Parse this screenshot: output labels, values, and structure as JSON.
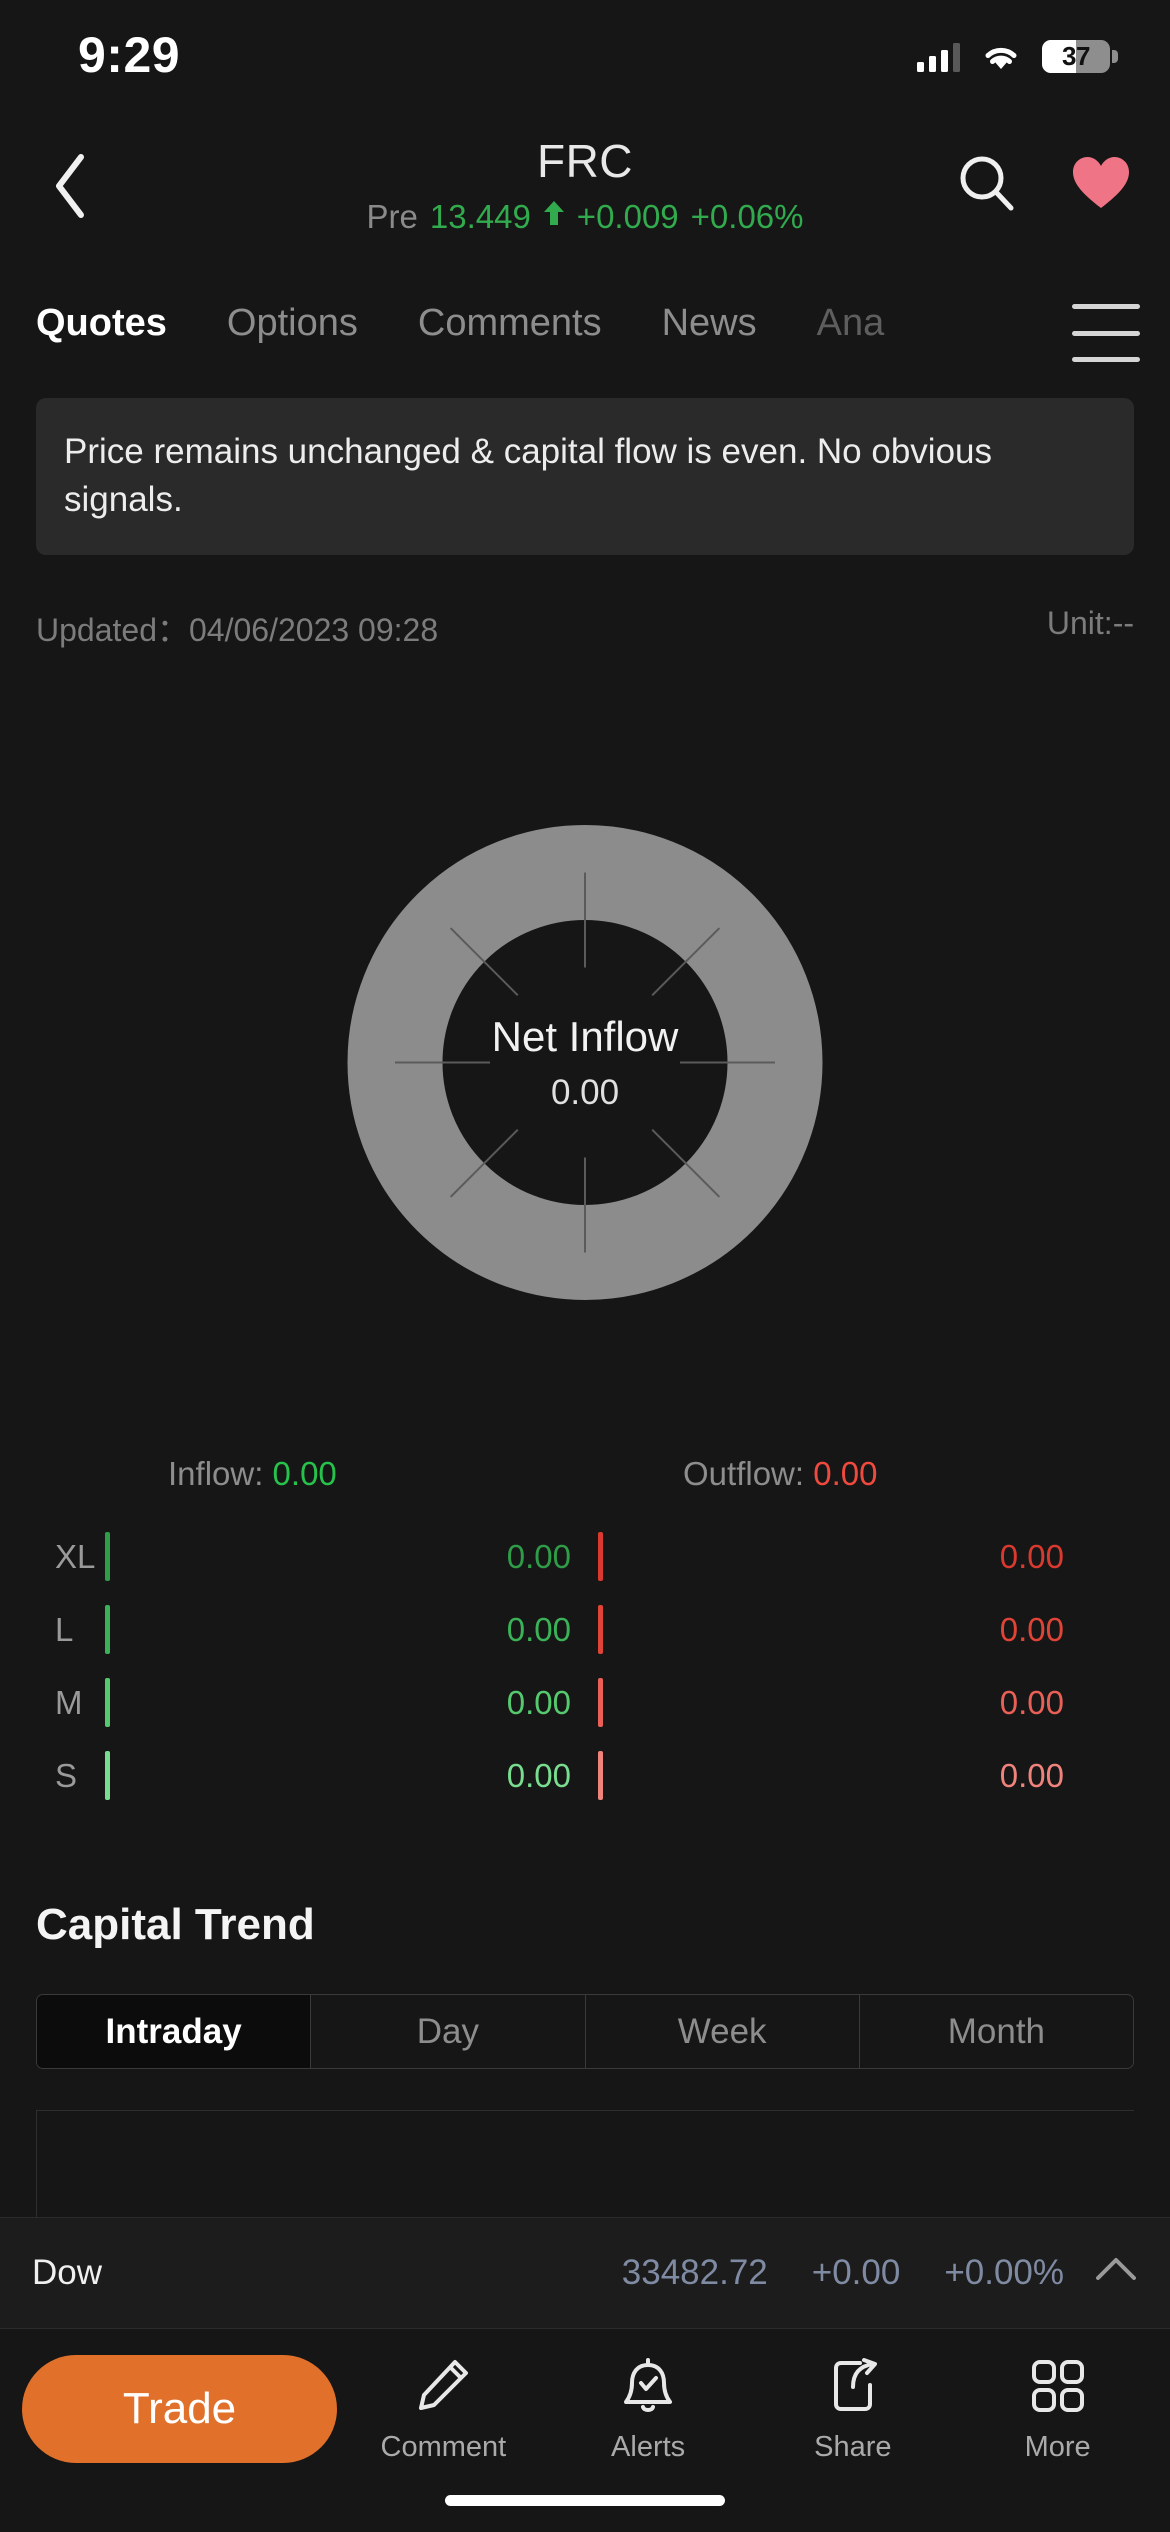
{
  "status_bar": {
    "time": "9:29",
    "battery_percent": "37",
    "icons": [
      "cellular-signal-icon",
      "wifi-icon",
      "battery-icon"
    ]
  },
  "header": {
    "back_icon": "chevron-left-icon",
    "symbol": "FRC",
    "session_label": "Pre",
    "last_price": "13.449",
    "direction_arrow": "⬆",
    "change": "+0.009",
    "change_percent": "+0.06%",
    "up_color": "#31ab4d",
    "search_icon": "search-icon",
    "favorite_icon": "heart-icon",
    "favorite_color": "#ef7486",
    "menu_icon": "hamburger-menu-icon"
  },
  "tabs": {
    "items": [
      {
        "label": "Quotes",
        "active": true
      },
      {
        "label": "Options",
        "active": false
      },
      {
        "label": "Comments",
        "active": false
      },
      {
        "label": "News",
        "active": false
      },
      {
        "label": "Ana",
        "active": false
      }
    ],
    "accent": "#e0702a"
  },
  "notice": {
    "text": "Price remains unchanged & capital flow is even. No obvious signals."
  },
  "meta": {
    "updated_label": "Updated：",
    "updated_value": "04/06/2023 09:28",
    "unit": "Unit:--"
  },
  "donut": {
    "center_label": "Net Inflow",
    "center_value": "0.00",
    "ring_color": "#8c8c8c",
    "segments": 8
  },
  "flow_summary": {
    "inflow_label": "Inflow:",
    "inflow_value": "0.00",
    "inflow_color": "#27c24c",
    "outflow_label": "Outflow:",
    "outflow_value": "0.00",
    "outflow_color": "#f04a3f"
  },
  "flow_rows": [
    {
      "label": "XL",
      "inflow": "0.00",
      "outflow": "0.00",
      "in_color": "#2f9c48",
      "out_color": "#d9392f"
    },
    {
      "label": "L",
      "inflow": "0.00",
      "outflow": "0.00",
      "in_color": "#3bb257",
      "out_color": "#e04437"
    },
    {
      "label": "M",
      "inflow": "0.00",
      "outflow": "0.00",
      "in_color": "#56c96f",
      "out_color": "#ea6057"
    },
    {
      "label": "S",
      "inflow": "0.00",
      "outflow": "0.00",
      "in_color": "#79dd90",
      "out_color": "#f0837c"
    }
  ],
  "capital_trend": {
    "title": "Capital Trend",
    "ranges": [
      {
        "label": "Intraday",
        "active": true
      },
      {
        "label": "Day",
        "active": false
      },
      {
        "label": "Week",
        "active": false
      },
      {
        "label": "Month",
        "active": false
      }
    ]
  },
  "index_ticker": {
    "name": "Dow",
    "price": "33482.72",
    "change": "+0.00",
    "change_percent": "+0.00%",
    "expand_icon": "chevron-up-icon",
    "value_color": "#7f8ba3"
  },
  "bottom_bar": {
    "trade_label": "Trade",
    "trade_color": "#e0702a",
    "actions": [
      {
        "label": "Comment",
        "icon": "pencil-icon"
      },
      {
        "label": "Alerts",
        "icon": "bell-check-icon"
      },
      {
        "label": "Share",
        "icon": "share-box-icon"
      },
      {
        "label": "More",
        "icon": "grid-four-icon"
      }
    ]
  },
  "chart_data": {
    "type": "pie",
    "title": "Net Inflow",
    "categories": [
      "XL Inflow",
      "L Inflow",
      "M Inflow",
      "S Inflow",
      "S Outflow",
      "M Outflow",
      "L Outflow",
      "XL Outflow"
    ],
    "values": [
      0,
      0,
      0,
      0,
      0,
      0,
      0,
      0
    ],
    "center_value": 0.0,
    "unit": "--",
    "legend_position": "below",
    "series": [
      {
        "name": "Inflow",
        "categories": [
          "XL",
          "L",
          "M",
          "S"
        ],
        "values": [
          0.0,
          0.0,
          0.0,
          0.0
        ]
      },
      {
        "name": "Outflow",
        "categories": [
          "XL",
          "L",
          "M",
          "S"
        ],
        "values": [
          0.0,
          0.0,
          0.0,
          0.0
        ]
      }
    ]
  }
}
